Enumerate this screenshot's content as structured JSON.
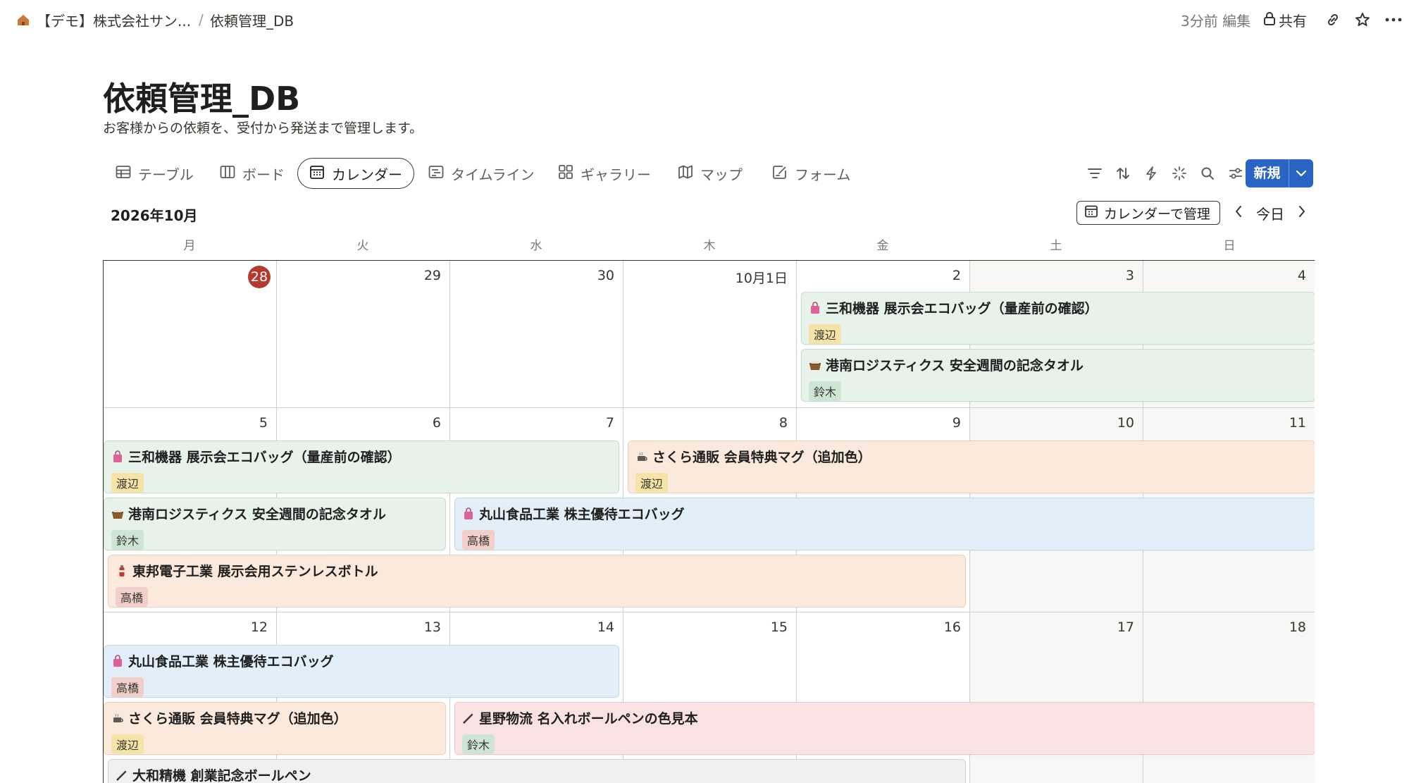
{
  "breadcrumb": {
    "workspace": "【デモ】株式会社サン...",
    "separator": "/",
    "database": "依頼管理_DB"
  },
  "topbar": {
    "edited": "3分前 編集",
    "share": "共有"
  },
  "page": {
    "title": "依頼管理_DB",
    "description": "お客様からの依頼を、受付から発送まで管理します。"
  },
  "views": [
    {
      "label": "テーブル",
      "icon": "table-icon"
    },
    {
      "label": "ボード",
      "icon": "board-icon"
    },
    {
      "label": "カレンダー",
      "icon": "calendar-icon",
      "active": true
    },
    {
      "label": "タイムライン",
      "icon": "timeline-icon"
    },
    {
      "label": "ギャラリー",
      "icon": "gallery-icon"
    },
    {
      "label": "マップ",
      "icon": "map-icon"
    },
    {
      "label": "フォーム",
      "icon": "form-icon"
    }
  ],
  "toolbar": {
    "icons": [
      "filter-icon",
      "sort-icon",
      "automation-icon",
      "ai-icon",
      "search-icon",
      "settings-icon"
    ],
    "new_label": "新規"
  },
  "calendar": {
    "month_label": "2026年10月",
    "manage_label": "カレンダーで管理",
    "today_label": "今日",
    "weekdays": [
      "月",
      "火",
      "水",
      "木",
      "金",
      "土",
      "日"
    ],
    "weeks": [
      [
        "28",
        "29",
        "30",
        "10月1日",
        "2",
        "3",
        "4"
      ],
      [
        "5",
        "6",
        "7",
        "8",
        "9",
        "10",
        "11"
      ],
      [
        "12",
        "13",
        "14",
        "15",
        "16",
        "17",
        "18"
      ]
    ],
    "today": "28"
  },
  "events": [
    {
      "title": "三和機器 展示会エコバッグ（量産前の確認）",
      "assignee": "渡辺",
      "icon": "bag-icon"
    },
    {
      "title": "港南ロジスティクス 安全週間の記念タオル",
      "assignee": "鈴木",
      "icon": "basket-icon"
    },
    {
      "title": "三和機器 展示会エコバッグ（量産前の確認）",
      "assignee": "渡辺",
      "icon": "bag-icon"
    },
    {
      "title": "さくら通販 会員特典マグ（追加色）",
      "assignee": "渡辺",
      "icon": "mug-icon"
    },
    {
      "title": "港南ロジスティクス 安全週間の記念タオル",
      "assignee": "鈴木",
      "icon": "basket-icon"
    },
    {
      "title": "丸山食品工業 株主優待エコバッグ",
      "assignee": "高橋",
      "icon": "bag-icon"
    },
    {
      "title": "東邦電子工業 展示会用ステンレスボトル",
      "assignee": "高橋",
      "icon": "bottle-icon"
    },
    {
      "title": "丸山食品工業 株主優待エコバッグ",
      "assignee": "高橋",
      "icon": "bag-icon"
    },
    {
      "title": "さくら通販 会員特典マグ（追加色）",
      "assignee": "渡辺",
      "icon": "mug-icon"
    },
    {
      "title": "星野物流 名入れボールペンの色見本",
      "assignee": "鈴木",
      "icon": "pen-icon"
    },
    {
      "title": "大和精機 創業記念ボールペン",
      "assignee": "",
      "icon": "pen-icon"
    }
  ]
}
